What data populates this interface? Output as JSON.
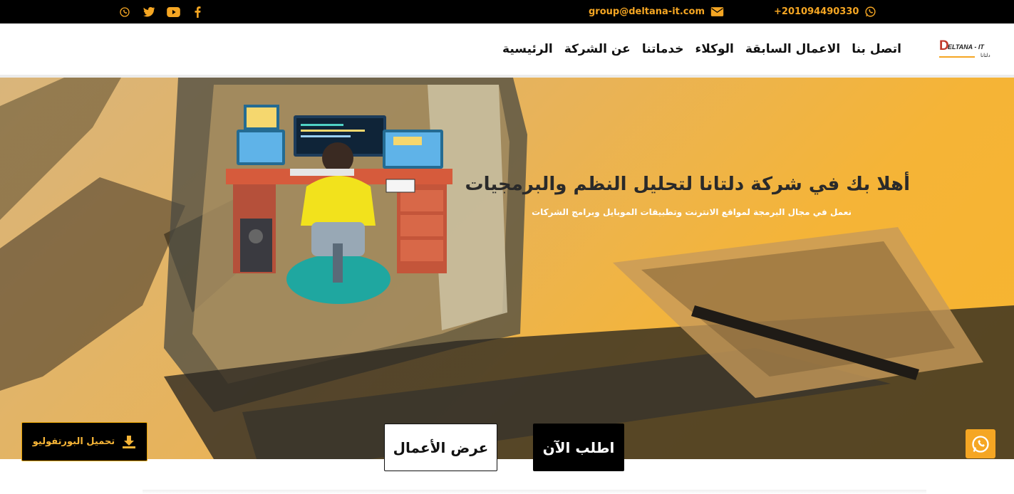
{
  "topbar": {
    "phone": "+201094490330",
    "email": "group@deltana-it.com",
    "social_icons": [
      "facebook-icon",
      "youtube-icon",
      "twitter-icon",
      "whatsapp-icon"
    ]
  },
  "brand": {
    "logo_text": "DELTANA - IT",
    "logo_sub": "دلتانا"
  },
  "nav": {
    "items": [
      "الرئيسية",
      "عن الشركة",
      "خدماتنا",
      "الوكلاء",
      "الاعمال السابقة",
      "اتصل بنا"
    ]
  },
  "hero": {
    "heading": "أهلا بك في شركة دلتانا لتحليل النظم والبرمجيات",
    "subheading": "نعمل في مجال البرمجة لمواقع الانترنت وتطبيقات الموبايل وبرامج الشركات"
  },
  "buttons": {
    "order_now": "اطلب الآن",
    "view_works": "عرض الأعمال",
    "download_portfolio": "تحميل البورتفوليو"
  },
  "colors": {
    "accent": "#f5a623",
    "topbar_bg": "#000000",
    "hero_tint": "#f5b437"
  }
}
